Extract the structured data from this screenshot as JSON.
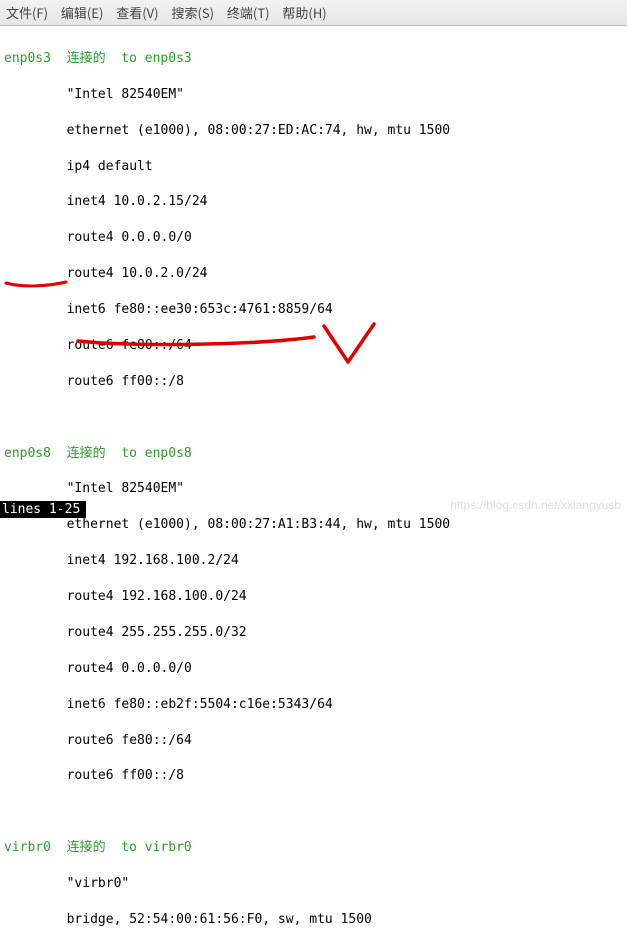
{
  "menubar": {
    "file": "文件(F)",
    "edit": "编辑(E)",
    "view": "查看(V)",
    "search": "搜索(S)",
    "terminal": "终端(T)",
    "help": "帮助(H)"
  },
  "ifaces": [
    {
      "name": "enp0s3",
      "state": "连接的",
      "to": "to enp0s3",
      "device": "\"Intel 82540EM\"",
      "lines": [
        "ethernet (e1000), 08:00:27:ED:AC:74, hw, mtu 1500",
        "ip4 default",
        "inet4 10.0.2.15/24",
        "route4 0.0.0.0/0",
        "route4 10.0.2.0/24",
        "inet6 fe80::ee30:653c:4761:8859/64",
        "route6 fe80::/64",
        "route6 ff00::/8"
      ]
    },
    {
      "name": "enp0s8",
      "state": "连接的",
      "to": "to enp0s8",
      "device": "\"Intel 82540EM\"",
      "lines": [
        "ethernet (e1000), 08:00:27:A1:B3:44, hw, mtu 1500",
        "inet4 192.168.100.2/24",
        "route4 192.168.100.0/24",
        "route4 255.255.255.0/32",
        "route4 0.0.0.0/0",
        "inet6 fe80::eb2f:5504:c16e:5343/64",
        "route6 fe80::/64",
        "route6 ff00::/8"
      ]
    },
    {
      "name": "virbr0",
      "state": "连接的",
      "to": "to virbr0",
      "device": "\"virbr0\"",
      "lines": [
        "bridge, 52:54:00:61:56:F0, sw, mtu 1500"
      ]
    }
  ],
  "statusbar": "lines 1-25",
  "watermark": "https://blog.csdn.net/xxiangyusb"
}
